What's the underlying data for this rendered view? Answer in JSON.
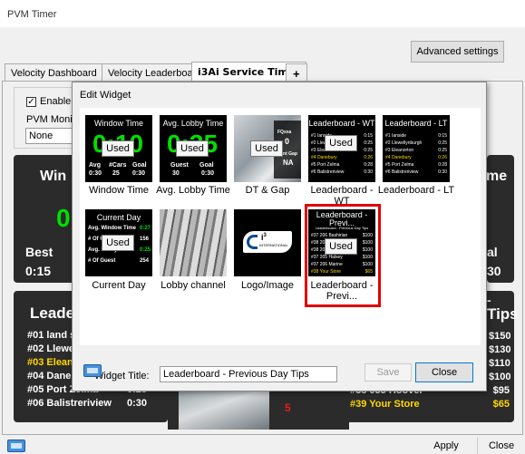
{
  "window": {
    "title": "PVM Timer"
  },
  "toolbar": {
    "advanced_label": "Advanced settings"
  },
  "tabs": [
    {
      "label": "Velocity Dashboard"
    },
    {
      "label": "Velocity Leaderboard"
    },
    {
      "label": "i3Ai Service Timer"
    },
    {
      "label": "+"
    }
  ],
  "settings": {
    "enable_label": "Enable",
    "monitor_label": "PVM Monitor",
    "monitor_value": "None"
  },
  "background": {
    "win_partial": "Win",
    "me_partial": "me",
    "best_label": "Best",
    "best_value": "0:15",
    "al_partial": "al",
    "al_value": "30",
    "leader_partial": "Leade",
    "tips_partial": "Tips",
    "dash": "-",
    "red_five": "5",
    "left_rows": [
      {
        "rank": "#01",
        "name": "land s",
        "time": ""
      },
      {
        "rank": "#02",
        "name": "Llewe",
        "time": ""
      },
      {
        "rank": "#03",
        "name": "Elean",
        "time": ""
      },
      {
        "rank": "#04",
        "name": "Dane",
        "time": ""
      },
      {
        "rank": "#05",
        "name": "Port Zelma",
        "time": "0:28"
      },
      {
        "rank": "#06",
        "name": "Balistreriview",
        "time": "0:30"
      }
    ],
    "right_amounts": [
      "$150",
      "$130",
      "$110",
      "$100",
      "$95",
      "$65"
    ],
    "right_rows": [
      {
        "rank": "#38",
        "name": "055 Hoover",
        "amount": "$95"
      },
      {
        "rank": "#39",
        "name": "Your Store",
        "amount": "$65"
      }
    ]
  },
  "dialog": {
    "title": "Edit Widget",
    "widget_title_label": "Widget Title:",
    "widget_title_value": "Leaderboard - Previous Day Tips",
    "save_label": "Save",
    "close_label": "Close",
    "used_label": "Used",
    "widgets": [
      {
        "label": "Window Time",
        "header": "Window Time",
        "big": "0:10",
        "used": true,
        "stats": [
          "Avg",
          "#Cars",
          "Goal",
          "0:30",
          "25",
          "0:30"
        ]
      },
      {
        "label": "Avg. Lobby Time",
        "header": "Avg. Lobby Time",
        "big": "0:35",
        "used": true,
        "stats": [
          "Guest",
          "Goal",
          "30",
          "0:30"
        ]
      },
      {
        "label": "DT & Gap",
        "header": "",
        "used": true,
        "overlay": [
          "FQxxa",
          "0",
          "Front Gap",
          "NA"
        ]
      },
      {
        "label": "Leaderboard - WT",
        "header": "Leaderboard - WT",
        "used": true,
        "rows": [
          [
            "#1 Ianside",
            "0:15"
          ],
          [
            "#2 Llewellynburgh",
            "0:25"
          ],
          [
            "#3 Eleanorton",
            "0:25"
          ],
          [
            "#4 Danebury",
            "0:26"
          ],
          [
            "#5 Port Zelma",
            "0:28"
          ],
          [
            "#6 Balistreriview",
            "0:30"
          ]
        ]
      },
      {
        "label": "Leaderboard - LT",
        "header": "Leaderboard - LT",
        "used": false,
        "rows": [
          [
            "#1 Ianside",
            "0:15"
          ],
          [
            "#2 Llewellynburgh",
            "0:25"
          ],
          [
            "#3 Eleanorton",
            "0:25"
          ],
          [
            "#4 Danebury",
            "0:26"
          ],
          [
            "#5 Port Zelma",
            "0:28"
          ],
          [
            "#6 Balistreriview",
            "0:30"
          ]
        ]
      },
      {
        "label": "Current Day",
        "header": "Current Day",
        "used": true,
        "stats": [
          "Avg. Window Time",
          "0:27",
          "# Of Cars",
          "156",
          "Avg. Lobby Time",
          "0:25",
          "# Of Guest",
          "254"
        ]
      },
      {
        "label": "Lobby channel",
        "header": "",
        "used": false
      },
      {
        "label": "Logo/Image",
        "header": "",
        "used": false,
        "logo": "INTERNATIONAL"
      },
      {
        "label": "Leaderboard - Previ...",
        "header": "Leaderboard - Previ...",
        "subheader": "Leaderboard - Previous Day Tips",
        "used": true,
        "selected": true,
        "rows": [
          [
            "#37 206 Bashirian",
            "$100"
          ],
          [
            "#38 205 Luke North",
            "$100"
          ],
          [
            "#38 202 Prairie",
            "$100"
          ],
          [
            "#37 205 Halsey",
            "$100"
          ],
          [
            "#37 206 Marine",
            "$100"
          ],
          [
            "#38 Your Store",
            "$65"
          ]
        ]
      }
    ]
  },
  "footer": {
    "apply_label": "Apply",
    "close_label": "Close"
  }
}
